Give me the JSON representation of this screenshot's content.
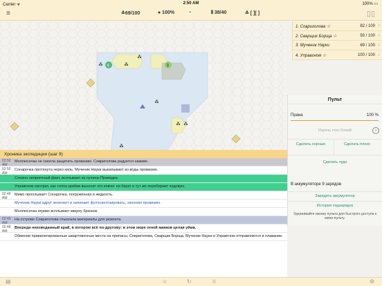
{
  "status": {
    "carrier": "Carrier ᯤ",
    "time": "2:50 AM",
    "battery": "100% ▭"
  },
  "topbar": {
    "temple": "≙69/100",
    "prana": "● 100%",
    "clock": "◔",
    "arks": "⫴ 38/40",
    "pairs": "≙ [ ][ ]"
  },
  "leaderboard": [
    {
      "name": "1. Совриголова ☆",
      "value": "82 / 100"
    },
    {
      "name": "2. Сварщик Борщa ☆",
      "value": "93 / 100"
    },
    {
      "name": "3. Мученик Науки",
      "value": "69 / 100"
    },
    {
      "name": "4. Упрaвгном ☆",
      "value": "100 / 100"
    }
  ],
  "console": {
    "title": "Пульт",
    "prana_label": "Прана",
    "prana_value": "100 %",
    "voice_placeholder": "Изречь глас божий",
    "good_label": "Сделать хорошо",
    "bad_label": "Сделать плохо",
    "miracle_label": "Сделать чудо",
    "accu_label": "В аккумуляторе 9 зарядов",
    "charge_label": "Зарядить аккумулятор",
    "history_label": "История подзарядок",
    "hint": "Удерживайте иконку пульта для быстрого доступа к мини-пульту."
  },
  "chronicle": {
    "title": "Хроника экспедиции (шаг 9)",
    "entries": [
      {
        "time": "02:50 AM",
        "text": "Моллюсечка не смогла защитить провизию. Совриголова радуется наживе.",
        "style": "gray"
      },
      {
        "time": "02:50 AM",
        "text": "Сонарочка протянута через киль. Мученик Науки выкапывает из воды провизию.",
        "style": ""
      },
      {
        "time": "",
        "text": "Словно неприятный факт, всплывает из пучины Преведка.",
        "style": "green"
      },
      {
        "time": "",
        "text": "Упрaвгном смотрит, как толпа крабов выносит его ковчег на берег и тут же перебирает ходовую.",
        "style": "green"
      },
      {
        "time": "02:49 AM",
        "text": "Мимо проплывает Сонарочка, погружённая в жидкость.",
        "style": ""
      },
      {
        "time": "",
        "text": "Мученик Науки вдруг зеленеет и начинает фотосинтезировать, экономя провизию.",
        "style": "link"
      },
      {
        "time": "",
        "text": "Моллюсечка игриво всплывает кверху брюхом.",
        "style": ""
      },
      {
        "time": "02:49 AM",
        "text": "На острове Совриголова отыскала материалы для ремонта.",
        "style": "blue"
      },
      {
        "time": "02:48 AM",
        "text": "Впереди неизведанный край, в котором всё по-другому: в этом море огней маяков целая уйма.",
        "style": "bold"
      },
      {
        "time": "",
        "text": "Обменяв привилегированные швартовочные места на припасы, Совриголова, Сварщик Борща, Мученик Науки и Упрaвгном отправляются в плавание.",
        "style": ""
      }
    ]
  },
  "map": {
    "markers": [
      "4",
      "3"
    ]
  },
  "bottombar": {
    "icons": [
      "list-icon",
      "user-icon",
      "refresh-icon",
      "trophy-icon",
      "settings-icon"
    ]
  }
}
